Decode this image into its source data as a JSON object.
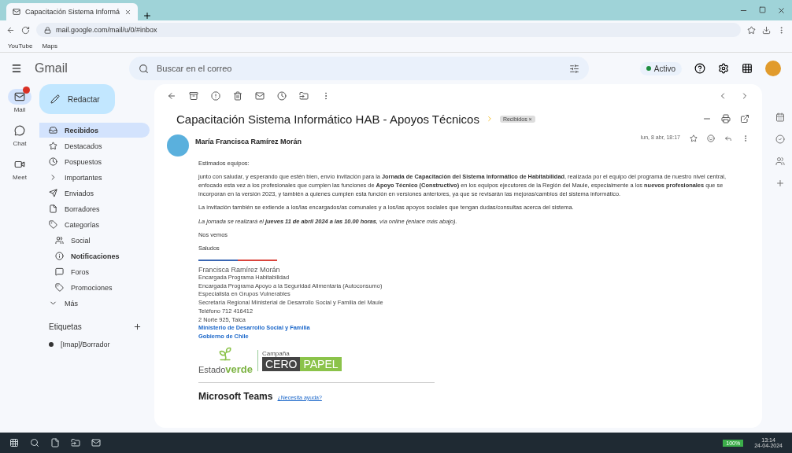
{
  "browser": {
    "tab_title": "Capacitación Sistema Informá",
    "url": "mail.google.com/mail/u/0/#inbox",
    "bookmarks": [
      "YouTube",
      "Maps"
    ]
  },
  "header": {
    "app_name": "Gmail",
    "search_placeholder": "Buscar en el correo",
    "status": "Activo"
  },
  "rail": [
    {
      "label": "Mail",
      "selected": true
    },
    {
      "label": "Chat",
      "selected": false
    },
    {
      "label": "Meet",
      "selected": false
    }
  ],
  "compose": "Redactar",
  "folders": [
    {
      "label": "Recibidos",
      "selected": true
    },
    {
      "label": "Destacados",
      "selected": false
    },
    {
      "label": "Pospuestos",
      "selected": false
    },
    {
      "label": "Importantes",
      "selected": false
    },
    {
      "label": "Enviados",
      "selected": false
    },
    {
      "label": "Borradores",
      "selected": false
    },
    {
      "label": "Categorías",
      "selected": false,
      "children": [
        {
          "label": "Social",
          "selected": false,
          "unread": false
        },
        {
          "label": "Notificaciones",
          "selected": false,
          "unread": true
        },
        {
          "label": "Foros",
          "selected": false,
          "unread": false
        },
        {
          "label": "Promociones",
          "selected": false,
          "unread": false
        }
      ]
    },
    {
      "label": "Más",
      "selected": false
    }
  ],
  "labels_title": "Etiquetas",
  "labels": [
    {
      "label": "[Imap]/Borrador",
      "color": "#333333"
    }
  ],
  "message": {
    "subject": "Capacitación Sistema Informático HAB - Apoyos Técnicos",
    "chip": "Recibidos ×",
    "sender": "María Francisca Ramírez Morán",
    "date": "lun, 8 abr, 18:17",
    "paragraphs": [
      {
        "text": "Estimados equipos:",
        "italic": false
      },
      {
        "text": "junto con saludar, y esperando que estén bien, envío invitación para la **Jornada de Capacitación del Sistema Informático de Habitabilidad**, realizada por el equipo del programa de nuestro nivel central, enfocado esta vez a los profesionales que cumplen las funciones de **Apoyo Técnico (Constructivo)** en los equipos ejecutores de la Región del Maule, especialmente a los **nuevos profesionales** que se incorporan en la versión 2023, y también a quienes cumplen esta función en versiones anteriores, ya que se revisarán las mejoras/cambios del sistema informático.",
        "italic": false
      },
      {
        "text": "La invitación también se extiende a los/las encargados/as comunales y a los/las apoyos sociales que tengan dudas/consultas acerca del sistema.",
        "italic": false
      },
      {
        "text": "La jornada se realizará el **jueves 11 de abril 2024 a las 10.00 horas**, vía online (enlace más abajo).",
        "italic": true
      },
      {
        "text": "Nos vemos",
        "italic": false
      },
      {
        "text": "Saludos",
        "italic": false
      }
    ],
    "signature": {
      "name": "Francisca Ramírez Morán",
      "lines": [
        {
          "text": "Encargada Programa Habitabilidad",
          "kind": "plain"
        },
        {
          "text": "Encargada Programa Apoyo a la Seguridad Alimentaria (Autoconsumo)",
          "kind": "plain"
        },
        {
          "text": "Especialista en Grupos Vulnerables",
          "kind": "plain"
        },
        {
          "text": "Secretaría Regional Ministerial de Desarrollo Social y Familia del Maule",
          "kind": "plain"
        },
        {
          "text": "Teléfono 712 416412",
          "kind": "plain"
        },
        {
          "text": "2 Norte 925, Talca",
          "kind": "plain"
        },
        {
          "text": "Ministerio de Desarrollo Social y Familia",
          "kind": "link"
        },
        {
          "text": "Gobierno de Chile",
          "kind": "link"
        }
      ]
    },
    "logo_left": {
      "word1": "Estado",
      "word2": "verde"
    },
    "logo_right": {
      "caption": "Campaña",
      "word1": "CERO",
      "word2": "PAPEL"
    },
    "teams_title": "Microsoft Teams",
    "teams_link": "¿Necesita ayuda?"
  },
  "taskbar": {
    "battery": "100%",
    "time": "13:14",
    "date": "24-04-2024"
  }
}
